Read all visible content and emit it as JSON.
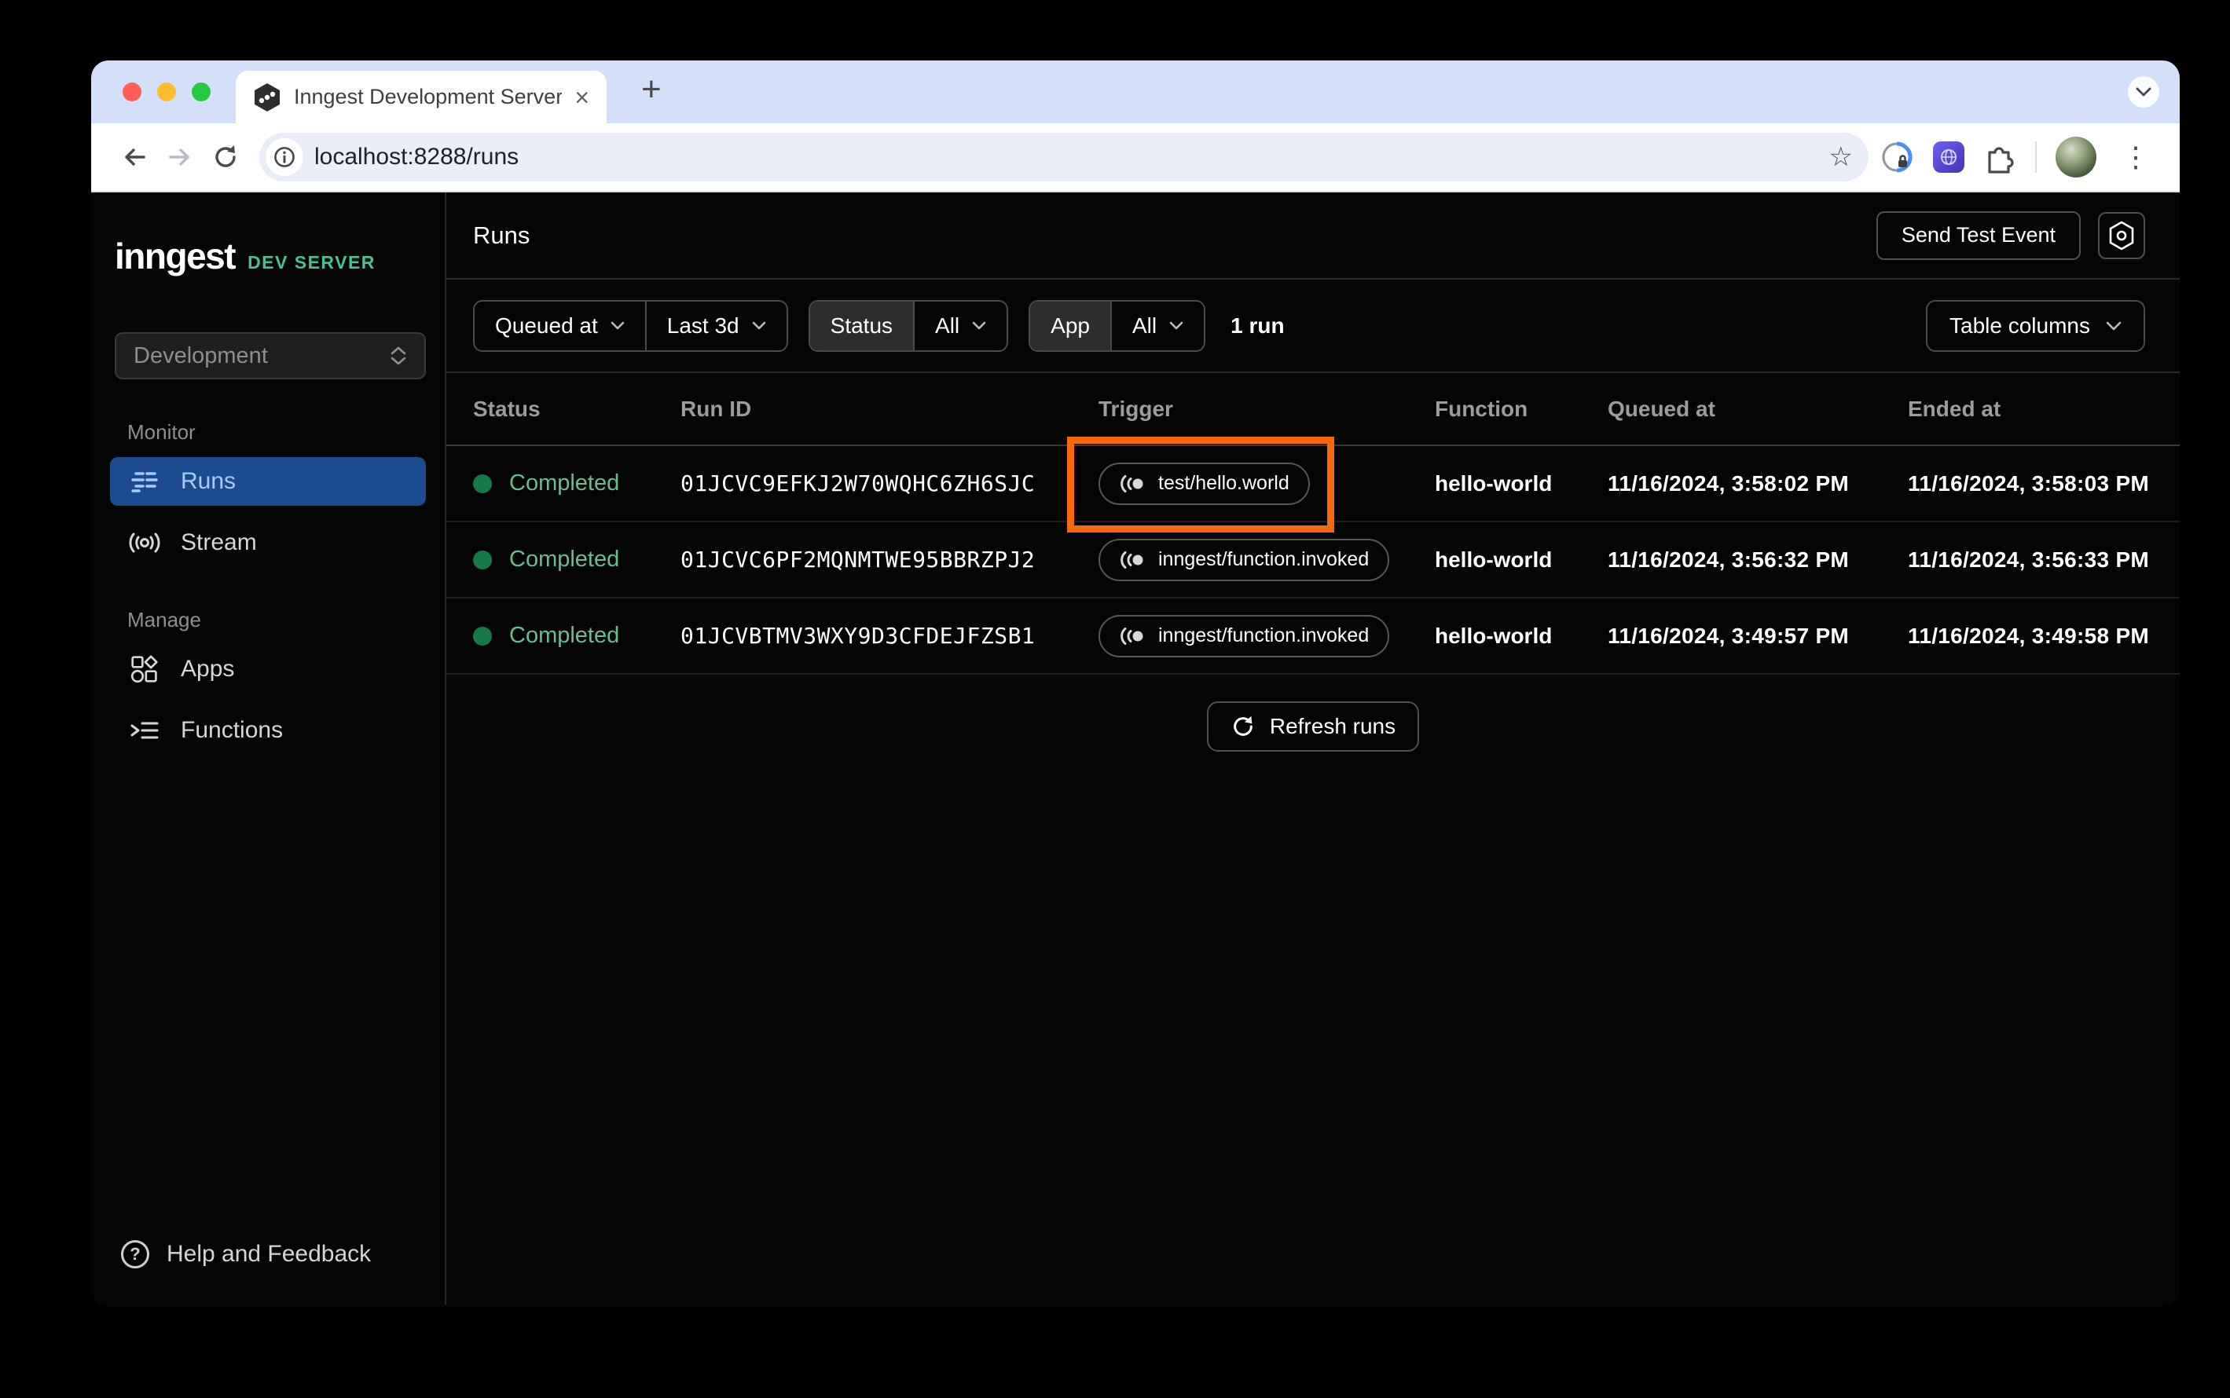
{
  "browser": {
    "tab_title": "Inngest Development Server",
    "url": "localhost:8288/runs"
  },
  "icons": {
    "close": "×",
    "plus": "+",
    "kebab": "⋮",
    "star": "☆",
    "help": "?"
  },
  "sidebar": {
    "logo": "inngest",
    "badge": "DEV SERVER",
    "env": "Development",
    "monitor_label": "Monitor",
    "runs": "Runs",
    "stream": "Stream",
    "manage_label": "Manage",
    "apps": "Apps",
    "functions": "Functions",
    "help": "Help and Feedback"
  },
  "header": {
    "title": "Runs",
    "send_test_event": "Send Test Event"
  },
  "filters": {
    "queued_at": "Queued at",
    "range": "Last 3d",
    "status_label": "Status",
    "status_value": "All",
    "app_label": "App",
    "app_value": "All",
    "count": "1 run",
    "table_columns": "Table columns"
  },
  "table": {
    "columns": [
      "Status",
      "Run ID",
      "Trigger",
      "Function",
      "Queued at",
      "Ended at"
    ],
    "rows": [
      {
        "status": "Completed",
        "run_id": "01JCVC9EFKJ2W70WQHC6ZH6SJC",
        "trigger": "test/hello.world",
        "function": "hello-world",
        "queued_at": "11/16/2024, 3:58:02 PM",
        "ended_at": "11/16/2024, 3:58:03 PM",
        "highlighted": true
      },
      {
        "status": "Completed",
        "run_id": "01JCVC6PF2MQNMTWE95BBRZPJ2",
        "trigger": "inngest/function.invoked",
        "function": "hello-world",
        "queued_at": "11/16/2024, 3:56:32 PM",
        "ended_at": "11/16/2024, 3:56:33 PM",
        "highlighted": false
      },
      {
        "status": "Completed",
        "run_id": "01JCVBTMV3WXY9D3CFDEJFZSB1",
        "trigger": "inngest/function.invoked",
        "function": "hello-world",
        "queued_at": "11/16/2024, 3:49:57 PM",
        "ended_at": "11/16/2024, 3:49:58 PM",
        "highlighted": false
      }
    ],
    "refresh_label": "Refresh runs"
  },
  "colors": {
    "highlight_orange": "#f76808",
    "active_nav_blue": "#1c4b8f",
    "status_dot_green": "#17794a",
    "completed_text_green": "#68bf8e",
    "dev_server_green": "#45c48f"
  }
}
